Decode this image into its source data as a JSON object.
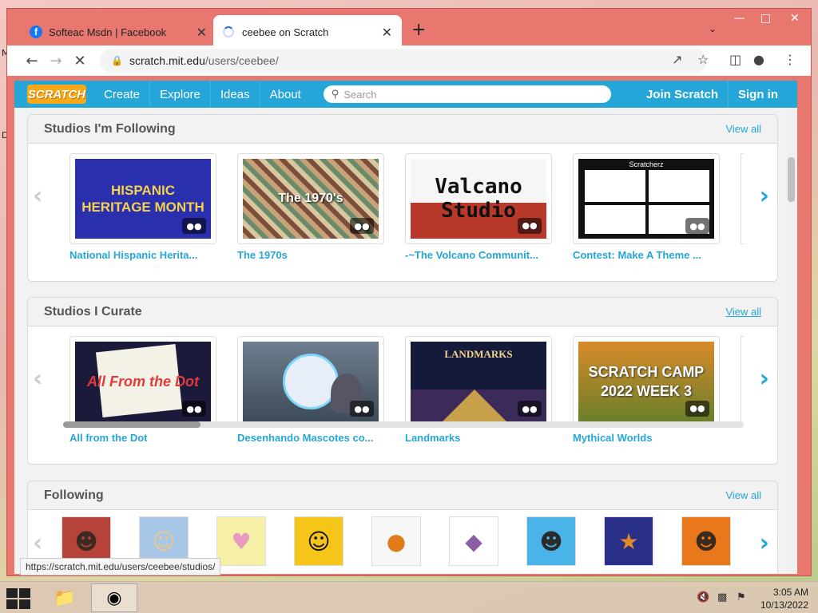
{
  "desktop": {
    "labels": [
      "M",
      "D"
    ]
  },
  "browser": {
    "tabs": [
      {
        "title": "Softeac Msdn | Facebook",
        "favicon": "f",
        "active": false
      },
      {
        "title": "ceebee on Scratch",
        "favicon": "loading-spinner",
        "active": true
      }
    ],
    "new_tab": "+",
    "url_host": "scratch.mit.edu",
    "url_path": "/users/ceebee/",
    "status_url": "https://scratch.mit.edu/users/ceebee/studios/"
  },
  "scratch_nav": {
    "logo": "SCRATCH",
    "links": [
      "Create",
      "Explore",
      "Ideas",
      "About"
    ],
    "search_placeholder": "Search",
    "join": "Join Scratch",
    "sign_in": "Sign in"
  },
  "sections": {
    "following_studios": {
      "title": "Studios I'm Following",
      "view_all": "View all",
      "cards": [
        {
          "title": "National Hispanic Herita...",
          "thumb_text": "HISPANIC HERITAGE MONTH"
        },
        {
          "title": "The 1970s",
          "thumb_text": "The 1970's"
        },
        {
          "title": "-~The Volcano Communit...",
          "thumb_text": "Valcano Studio"
        },
        {
          "title": "Contest: Make A Theme ...",
          "thumb_text": "Scratcherz"
        }
      ]
    },
    "curate_studios": {
      "title": "Studios I Curate",
      "view_all": "View all",
      "cards": [
        {
          "title": "All from the Dot",
          "thumb_text": "All From the Dot"
        },
        {
          "title": "Desenhando Mascotes co...",
          "thumb_text": ""
        },
        {
          "title": "Landmarks",
          "thumb_text": "LANDMARKS"
        },
        {
          "title": "Mythical Worlds",
          "thumb_text": "SCRATCH CAMP 2022 WEEK 3"
        }
      ]
    },
    "following": {
      "title": "Following",
      "view_all": "View all",
      "avatars": 9
    }
  },
  "taskbar": {
    "time": "3:05 AM",
    "date": "10/13/2022"
  },
  "colors": {
    "scratch_blue": "#25a6d9",
    "chrome_frame": "#e8776f"
  }
}
